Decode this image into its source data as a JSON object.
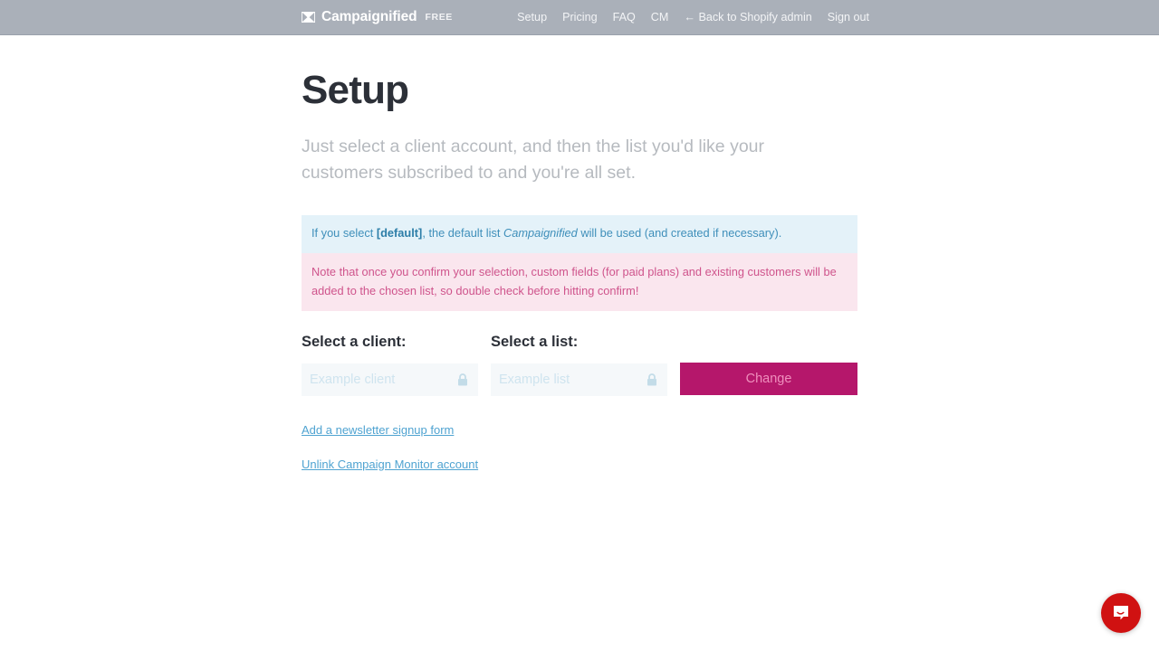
{
  "header": {
    "brand_icon": "envelope-logo-icon",
    "brand_name": "Campaignified",
    "plan_badge": "FREE",
    "nav": [
      {
        "label": "Setup",
        "name": "nav-setup"
      },
      {
        "label": "Pricing",
        "name": "nav-pricing"
      },
      {
        "label": "FAQ",
        "name": "nav-faq"
      },
      {
        "label": "CM",
        "name": "nav-cm"
      },
      {
        "label": "← Back to Shopify admin",
        "name": "nav-back-to-shopify-admin"
      },
      {
        "label": "Sign out",
        "name": "nav-sign-out"
      }
    ]
  },
  "main": {
    "title": "Setup",
    "subtitle": "Just select a client account, and then the list you'd like your customers subscribed to and you're all set.",
    "alerts": {
      "info": {
        "prefix": "If you select ",
        "strong": "[default]",
        "middle": ", the default list ",
        "emphasis": "Campaignified",
        "suffix": " will be used (and created if necessary)."
      },
      "warning": "Note that once you confirm your selection, custom fields (for paid plans) and existing customers will be added to the chosen list, so double check before hitting confirm!"
    },
    "form": {
      "client": {
        "label": "Select a client:",
        "value": "",
        "placeholder": "Example client",
        "locked": true,
        "lock_icon": "lock-icon"
      },
      "list": {
        "label": "Select a list:",
        "value": "",
        "placeholder": "Example list",
        "locked": true,
        "lock_icon": "lock-icon"
      },
      "change_button": "Change"
    },
    "links": [
      {
        "label": "Add a newsletter signup form",
        "name": "link-add-newsletter-signup-form"
      },
      {
        "label": "Unlink Campaign Monitor account",
        "name": "link-unlink-campaign-monitor-account"
      }
    ]
  },
  "widgets": {
    "intercom": {
      "icon": "chat-bubble-icon",
      "color": "#d01111"
    }
  },
  "colors": {
    "topbar": "#aab0b9",
    "title": "#2c3038",
    "subtitle": "#b6babf",
    "alert_info_bg": "#e4f2f9",
    "alert_info_text": "#3f8fba",
    "alert_warn_bg": "#fae6ee",
    "alert_warn_text": "#cf548c",
    "input_bg": "#f5f8fa",
    "placeholder": "#cfe4ef",
    "button_bg": "#b5176b",
    "button_text": "#ef8fbd",
    "link": "#4fa3d1"
  }
}
